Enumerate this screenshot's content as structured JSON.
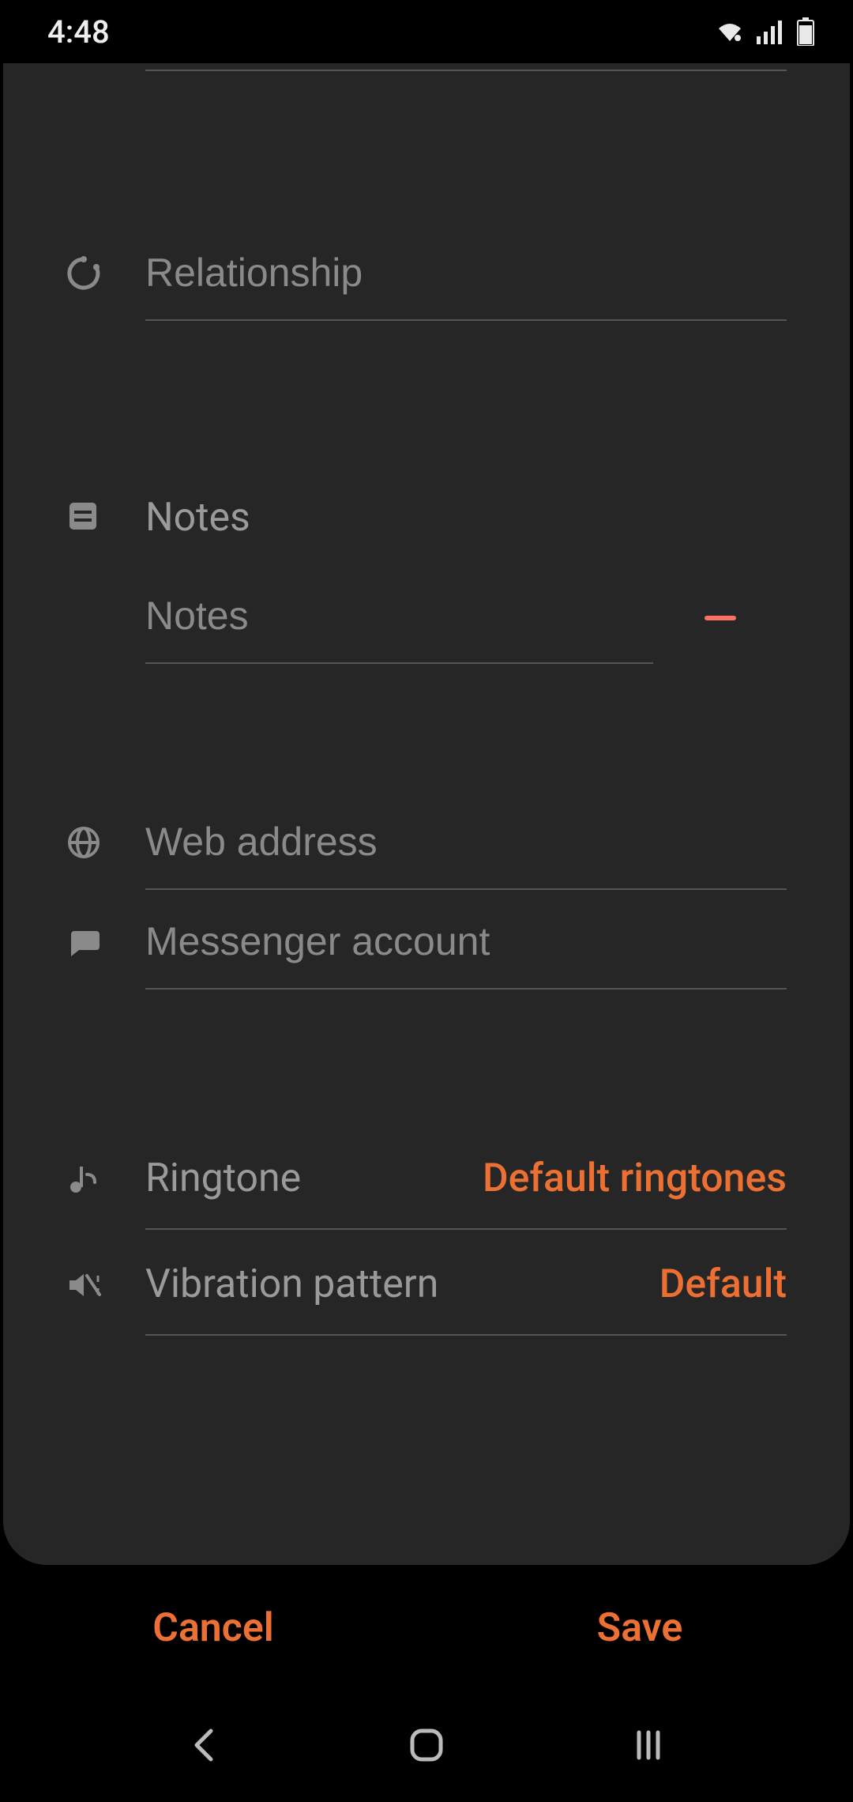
{
  "status": {
    "time": "4:48"
  },
  "fields": {
    "relationship": {
      "placeholder": "Relationship",
      "value": ""
    },
    "notes_label": "Notes",
    "notes": {
      "placeholder": "Notes",
      "value": ""
    },
    "web": {
      "placeholder": "Web address",
      "value": ""
    },
    "messenger": {
      "placeholder": "Messenger account",
      "value": ""
    }
  },
  "selectors": {
    "ringtone": {
      "label": "Ringtone",
      "value": "Default ringtones"
    },
    "vibration": {
      "label": "Vibration pattern",
      "value": "Default"
    }
  },
  "actions": {
    "cancel": "Cancel",
    "save": "Save"
  }
}
